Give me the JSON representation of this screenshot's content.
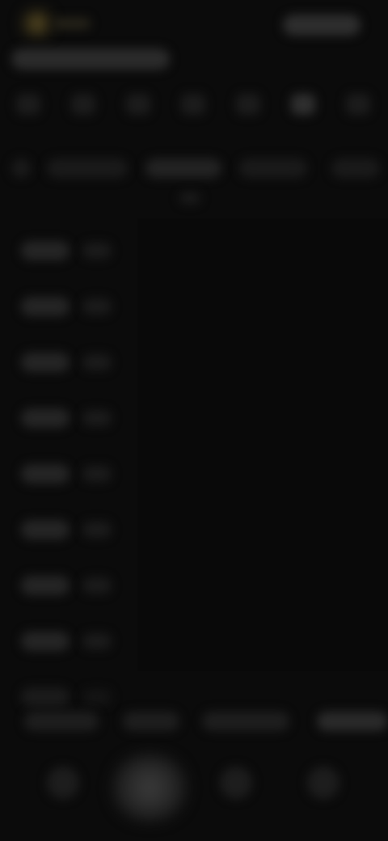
{
  "app": {
    "logo_icon": "app-logo-icon",
    "top_right_icon": "account-pill-icon"
  },
  "colors": {
    "background": "#0b0b0b",
    "accent": "#6b5a2a",
    "surface": "#2b2b2b"
  },
  "icon_row": [
    {
      "icon": "category-icon-1"
    },
    {
      "icon": "category-icon-2"
    },
    {
      "icon": "category-icon-3"
    },
    {
      "icon": "category-icon-4"
    },
    {
      "icon": "category-icon-5"
    },
    {
      "icon": "category-icon-6"
    },
    {
      "icon": "category-icon-7"
    }
  ],
  "tabs": [
    {
      "icon": "tab-dot-icon"
    },
    {
      "icon": "tab-icon-1"
    },
    {
      "icon": "tab-icon-2"
    },
    {
      "icon": "tab-icon-3"
    },
    {
      "icon": "tab-icon-4"
    }
  ],
  "list_rows": 9,
  "chips": [
    {
      "icon": "chip-icon-1"
    },
    {
      "icon": "chip-icon-2"
    },
    {
      "icon": "chip-icon-3"
    },
    {
      "icon": "chip-icon-4"
    }
  ],
  "bottom_nav": [
    {
      "icon": "home-icon"
    },
    {
      "icon": "center-action-icon"
    },
    {
      "icon": "nav-icon-3"
    },
    {
      "icon": "nav-icon-4"
    }
  ]
}
